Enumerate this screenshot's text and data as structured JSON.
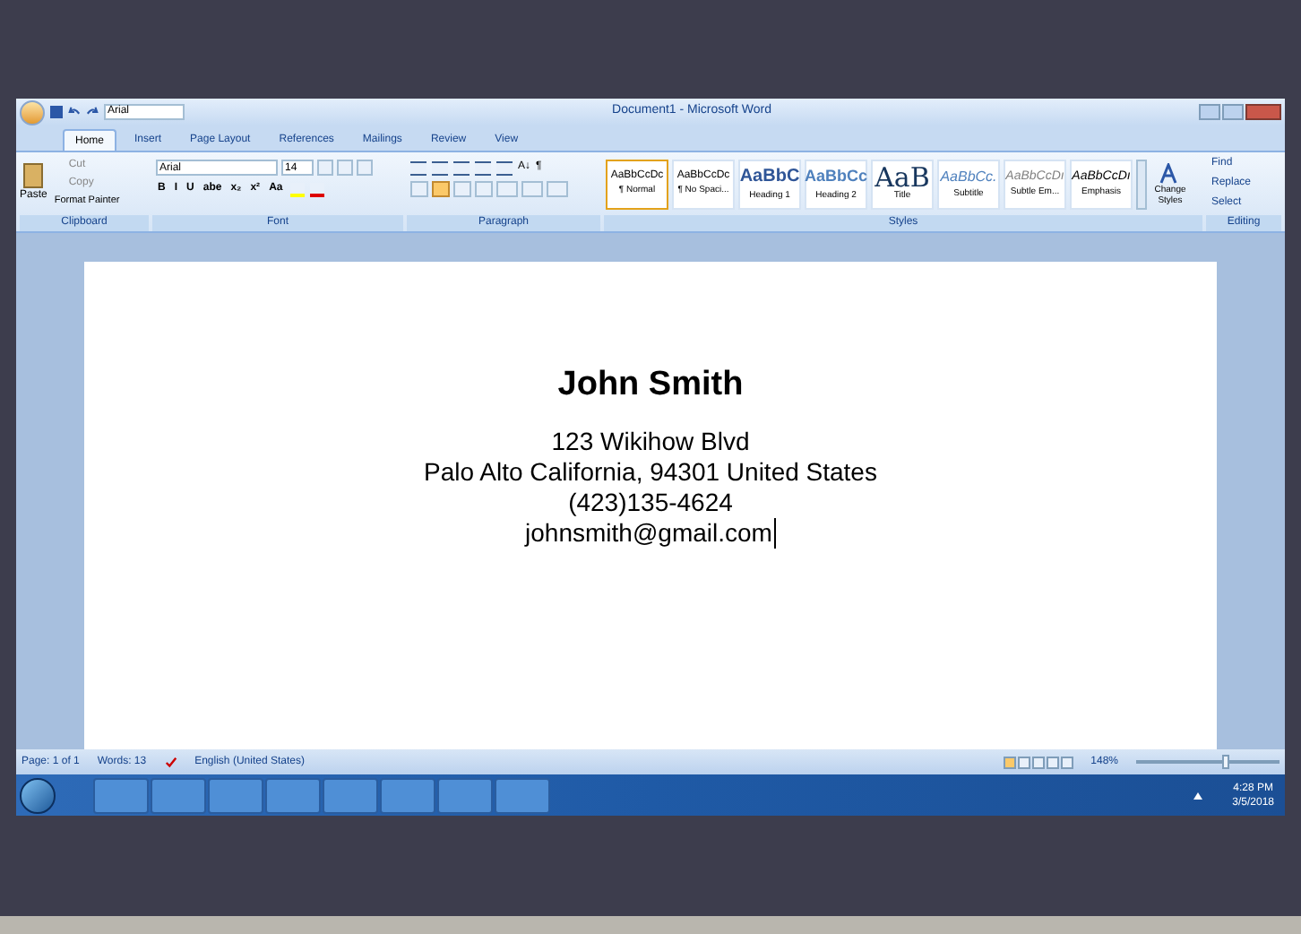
{
  "window": {
    "title": "Document1 - Microsoft Word",
    "quick_access_font": "Arial"
  },
  "tabs": [
    {
      "label": "Home",
      "selected": true
    },
    {
      "label": "Insert",
      "selected": false
    },
    {
      "label": "Page Layout",
      "selected": false
    },
    {
      "label": "References",
      "selected": false
    },
    {
      "label": "Mailings",
      "selected": false
    },
    {
      "label": "Review",
      "selected": false
    },
    {
      "label": "View",
      "selected": false
    }
  ],
  "clipboard": {
    "paste": "Paste",
    "cut": "Cut",
    "copy": "Copy",
    "format_painter": "Format Painter",
    "label": "Clipboard"
  },
  "font": {
    "name": "Arial",
    "size": "14",
    "buttons": [
      "B",
      "I",
      "U",
      "abe",
      "x₂",
      "x²",
      "Aa"
    ],
    "label": "Font"
  },
  "paragraph": {
    "alignments": [
      {
        "selected": false
      },
      {
        "selected": true
      },
      {
        "selected": false
      },
      {
        "selected": false
      }
    ],
    "sort": "A↓",
    "pilcrow": "¶",
    "label": "Paragraph"
  },
  "styles": {
    "items": [
      {
        "preview": "AaBbCcDc",
        "name": "¶ Normal",
        "kind": "normal",
        "selected": true
      },
      {
        "preview": "AaBbCcDc",
        "name": "¶ No Spaci...",
        "kind": "normal",
        "selected": false
      },
      {
        "preview": "AaBbC",
        "name": "Heading 1",
        "kind": "heading",
        "selected": false
      },
      {
        "preview": "AaBbCc",
        "name": "Heading 2",
        "kind": "heading2",
        "selected": false
      },
      {
        "preview": "AaB",
        "name": "Title",
        "kind": "title",
        "selected": false
      },
      {
        "preview": "AaBbCc.",
        "name": "Subtitle",
        "kind": "subtitle",
        "selected": false
      },
      {
        "preview": "AaBbCcDı",
        "name": "Subtle Em...",
        "kind": "subtle",
        "selected": false
      },
      {
        "preview": "AaBbCcDı",
        "name": "Emphasis",
        "kind": "emphasis",
        "selected": false
      }
    ],
    "change_styles": "Change Styles",
    "label": "Styles"
  },
  "editing": {
    "items": [
      "Find",
      "Replace",
      "Select"
    ],
    "label": "Editing"
  },
  "document": {
    "lines": [
      {
        "text": "John Smith",
        "kind": "heading"
      },
      {
        "text": "123 Wikihow Blvd",
        "kind": "body"
      },
      {
        "text": "Palo Alto California, 94301 United States",
        "kind": "body"
      },
      {
        "text": "(423)135-4624",
        "kind": "body"
      },
      {
        "text": "johnsmith@gmail.com",
        "kind": "caret"
      }
    ]
  },
  "status_bar": {
    "page": "Page: 1 of 1",
    "words": "Words: 13",
    "language": "English (United States)",
    "zoom": "148%",
    "level": 0.6
  },
  "taskbar": {
    "time": "4:28 PM",
    "date": "3/5/2018"
  }
}
